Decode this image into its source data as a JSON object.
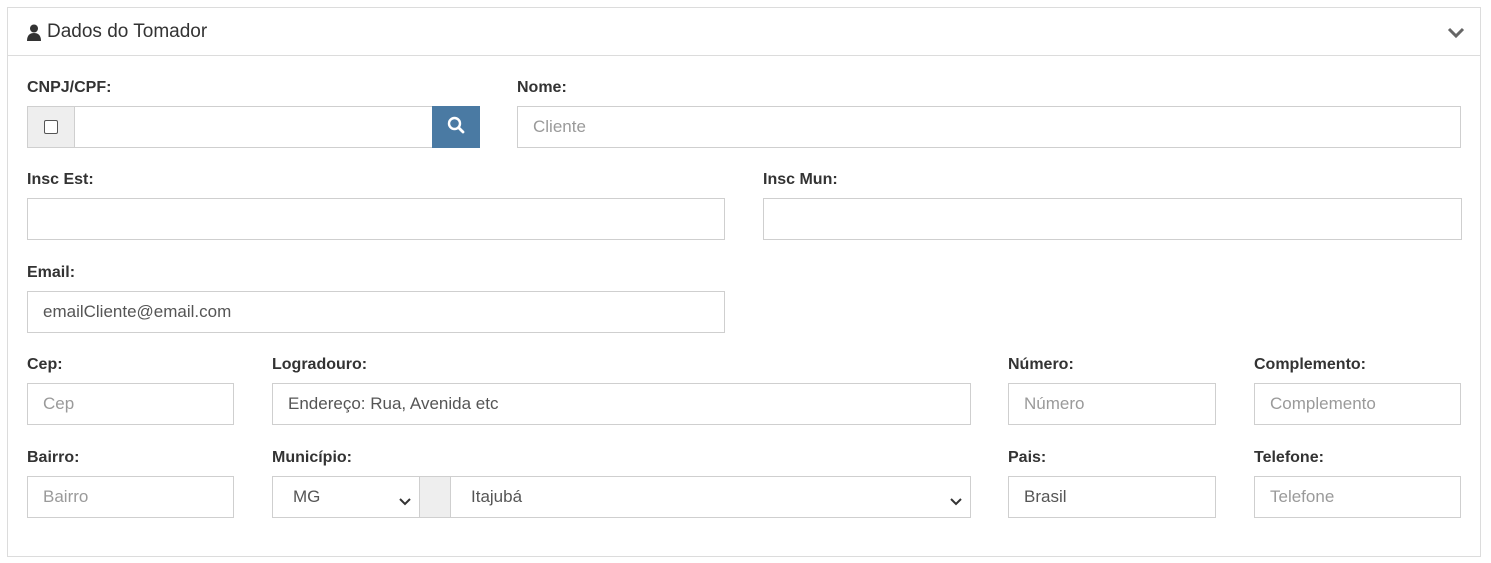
{
  "panel": {
    "title": "Dados do Tomador",
    "icon": "user-icon",
    "toggle_icon": "chevron-down-icon"
  },
  "fields": {
    "cnpj": {
      "label": "CNPJ/CPF:",
      "value": "",
      "placeholder": ""
    },
    "nome": {
      "label": "Nome:",
      "placeholder": "Cliente"
    },
    "insc_est": {
      "label": "Insc Est:",
      "value": ""
    },
    "insc_mun": {
      "label": "Insc Mun:",
      "value": ""
    },
    "email": {
      "label": "Email:",
      "placeholder": "emailCliente@email.com"
    },
    "cep": {
      "label": "Cep:",
      "placeholder": "Cep"
    },
    "logradouro": {
      "label": "Logradouro:",
      "placeholder": "Endereço: Rua, Avenida etc"
    },
    "numero": {
      "label": "Número:",
      "placeholder": "Número"
    },
    "complemento": {
      "label": "Complemento:",
      "placeholder": "Complemento"
    },
    "bairro": {
      "label": "Bairro:",
      "placeholder": "Bairro"
    },
    "municipio": {
      "label": "Município:",
      "uf_selected": "MG",
      "city_selected": "Itajubá"
    },
    "pais": {
      "label": "Pais:",
      "value": "Brasil"
    },
    "telefone": {
      "label": "Telefone:",
      "placeholder": "Telefone"
    }
  },
  "colors": {
    "search_button": "#4a7aa3",
    "border": "#cfcfcf",
    "addon_bg": "#eeeeee"
  }
}
